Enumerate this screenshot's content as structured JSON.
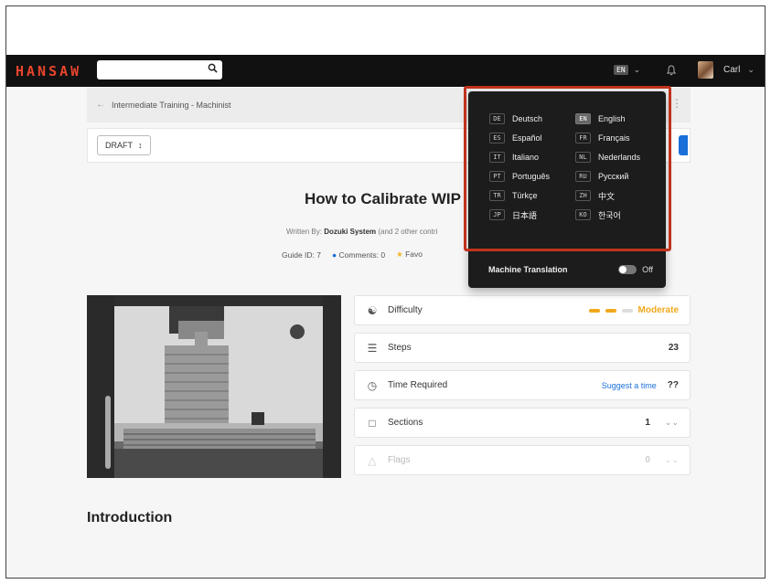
{
  "navbar": {
    "brand": "HANSAW",
    "search_placeholder": "",
    "language_badge": "EN",
    "user_name": "Carl"
  },
  "breadcrumb": {
    "label": "Intermediate Training - Machinist"
  },
  "status": {
    "draft_label": "DRAFT"
  },
  "guide": {
    "title": "How to Calibrate WIP",
    "written_by_prefix": "Written By:",
    "author": "Dozuki System",
    "contributors": "(and 2 other contri",
    "guide_id_label": "Guide ID: 7",
    "comments_label": "Comments: 0",
    "favorites_label": "Favo"
  },
  "stats": {
    "difficulty": {
      "label": "Difficulty",
      "value": "Moderate",
      "level_filled": 2,
      "level_total": 3
    },
    "steps": {
      "label": "Steps",
      "value": "23"
    },
    "time": {
      "label": "Time Required",
      "suggest": "Suggest a time",
      "value": "??"
    },
    "sections": {
      "label": "Sections",
      "value": "1"
    },
    "flags": {
      "label": "Flags",
      "value": "0"
    }
  },
  "intro": {
    "heading": "Introduction"
  },
  "language_menu": {
    "languages": [
      {
        "code": "DE",
        "name": "Deutsch",
        "active": false
      },
      {
        "code": "EN",
        "name": "English",
        "active": true
      },
      {
        "code": "ES",
        "name": "Español",
        "active": false
      },
      {
        "code": "FR",
        "name": "Français",
        "active": false
      },
      {
        "code": "IT",
        "name": "Italiano",
        "active": false
      },
      {
        "code": "NL",
        "name": "Nederlands",
        "active": false
      },
      {
        "code": "PT",
        "name": "Português",
        "active": false
      },
      {
        "code": "RU",
        "name": "Русский",
        "active": false
      },
      {
        "code": "TR",
        "name": "Türkçe",
        "active": false
      },
      {
        "code": "ZH",
        "name": "中文",
        "active": false
      },
      {
        "code": "JP",
        "name": "日本語",
        "active": false
      },
      {
        "code": "KO",
        "name": "한국어",
        "active": false
      }
    ],
    "machine_translation_label": "Machine Translation",
    "machine_translation_state": "Off"
  },
  "colors": {
    "brand": "#e8452c",
    "highlight": "#c0331c",
    "accent": "#1a6fd8",
    "difficulty": "#f0a91c"
  }
}
